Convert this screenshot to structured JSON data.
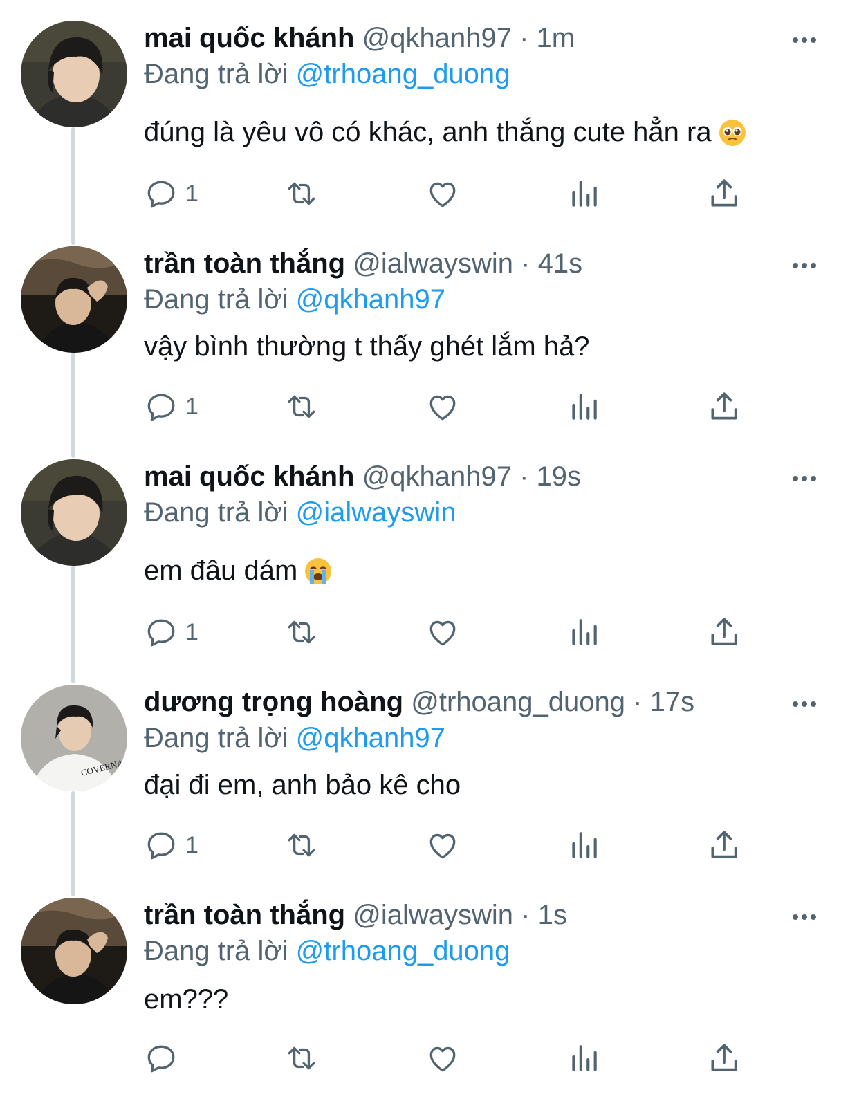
{
  "tweets": [
    {
      "name": "mai quốc khánh",
      "handle": "@qkhanh97",
      "dot": "·",
      "time": "1m",
      "replying_prefix": "Đang trả lời",
      "replying_to": "@trhoang_duong",
      "text": "đúng là yêu vô có khác, anh thắng cute hẳn ra",
      "emoji": "pleading-face",
      "reply_count": "1"
    },
    {
      "name": "trần toàn thắng",
      "handle": "@ialwayswin",
      "dot": "·",
      "time": "41s",
      "replying_prefix": "Đang trả lời",
      "replying_to": "@qkhanh97",
      "text": "vậy bình thường t thấy ghét lắm hả?",
      "reply_count": "1"
    },
    {
      "name": "mai quốc khánh",
      "handle": "@qkhanh97",
      "dot": "·",
      "time": "19s",
      "replying_prefix": "Đang trả lời",
      "replying_to": "@ialwayswin",
      "text": "em đâu dám",
      "emoji": "loudly-crying-face",
      "reply_count": "1"
    },
    {
      "name": "dương trọng hoàng",
      "handle": "@trhoang_duong",
      "dot": "·",
      "time": "17s",
      "replying_prefix": "Đang trả lời",
      "replying_to": "@qkhanh97",
      "text": "đại đi em, anh bảo kê cho",
      "reply_count": "1"
    },
    {
      "name": "trần toàn thắng",
      "handle": "@ialwayswin",
      "dot": "·",
      "time": "1s",
      "replying_prefix": "Đang trả lời",
      "replying_to": "@trhoang_duong",
      "text": "em???",
      "reply_count": ""
    }
  ],
  "avatar_shirt_text": "COVERNAT",
  "colors": {
    "accent": "#1d9bf0",
    "secondary": "#536471",
    "thread_line": "#cfd9de"
  }
}
